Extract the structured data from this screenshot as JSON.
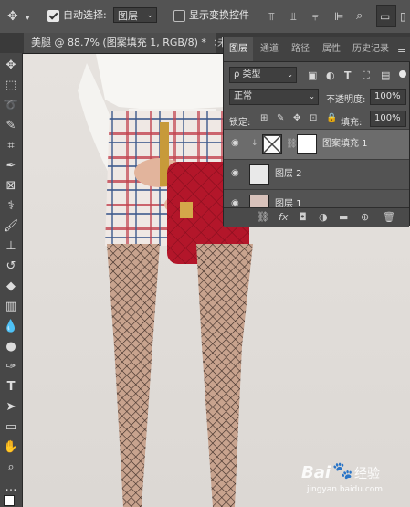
{
  "options_bar": {
    "auto_select_label": "自动选择:",
    "auto_select_value": "图层",
    "show_transform_label": "显示变换控件"
  },
  "document_tab": {
    "title": "美腿 @ 88.7% (图案填充 1, RGB/8) *",
    "close_symbol": "×",
    "next_tab_fragment": "未"
  },
  "layers_panel": {
    "tabs": [
      "图层",
      "通道",
      "路径",
      "属性",
      "历史记录"
    ],
    "active_tab": "图层",
    "filter_label": "ρ 类型",
    "blend_mode": "正常",
    "opacity_label": "不透明度:",
    "opacity_value": "100%",
    "lock_label": "锁定:",
    "fill_label": "填充:",
    "fill_value": "100%",
    "layers": [
      {
        "name": "图案填充 1",
        "selected": true
      },
      {
        "name": "图层 2",
        "selected": false
      },
      {
        "name": "图层 1",
        "selected": false
      }
    ],
    "bottom_icons": [
      "link-icon",
      "fx-icon",
      "mask-icon",
      "adjustment-icon",
      "folder-icon",
      "new-layer-icon",
      "trash-icon"
    ],
    "fx_label": "fx"
  },
  "watermark": {
    "brand": "Bai",
    "brand_suffix": "经验",
    "url": "jingyan.baidu.com"
  },
  "colors": {
    "ui_dark": "#535353",
    "canvas_bg": "#e0dcd8",
    "bag_red": "#b3162a"
  }
}
